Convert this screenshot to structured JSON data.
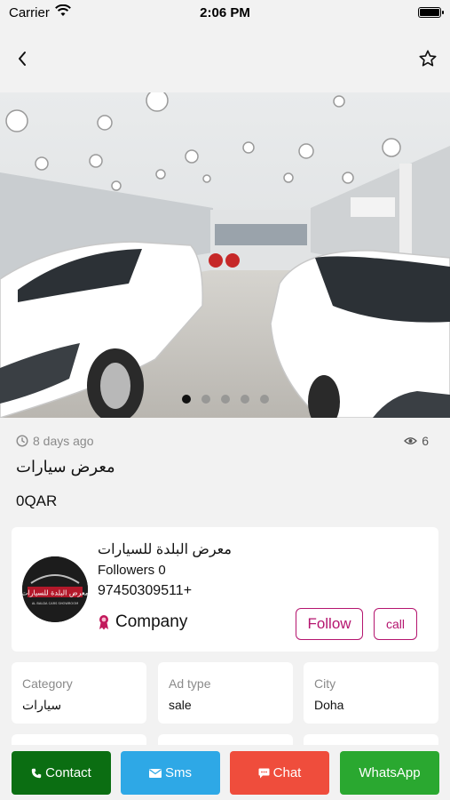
{
  "status_bar": {
    "carrier": "Carrier",
    "time": "2:06 PM"
  },
  "nav": {
    "back_icon": "chevron-left-icon",
    "favorite_icon": "star-outline-icon"
  },
  "gallery": {
    "image_count": 5,
    "active_index": 0
  },
  "ad": {
    "posted": "8 days ago",
    "views": "6",
    "title": "معرض سيارات",
    "price": "0QAR"
  },
  "seller": {
    "name": "معرض البلدة للسيارات",
    "followers": "Followers 0",
    "phone": "97450309511+",
    "type": "Company",
    "logo_text": "معرض البلدة للسيارات",
    "logo_subtext": "AL BALDA CARS SHOWROOM",
    "follow_label": "Follow",
    "call_label": "call"
  },
  "details": [
    {
      "label": "Category",
      "value": "سيارات"
    },
    {
      "label": "Ad type",
      "value": "sale"
    },
    {
      "label": "City",
      "value": "Doha"
    }
  ],
  "actions": {
    "contact": "Contact",
    "sms": "Sms",
    "chat": "Chat",
    "whatsapp": "WhatsApp"
  },
  "colors": {
    "accent": "#b5156f",
    "contact": "#0b6e12",
    "sms": "#2ea8e6",
    "chat": "#ef4d3c",
    "whatsapp": "#2aa830"
  }
}
